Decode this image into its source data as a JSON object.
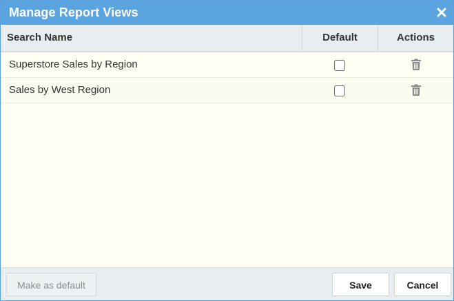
{
  "dialog": {
    "title": "Manage Report Views",
    "close_icon": "close-icon"
  },
  "table": {
    "columns": {
      "name": "Search Name",
      "default": "Default",
      "actions": "Actions"
    },
    "rows": [
      {
        "name": "Superstore Sales by Region",
        "default": false,
        "action_icon": "trash-icon"
      },
      {
        "name": "Sales by West Region",
        "default": false,
        "action_icon": "trash-icon"
      }
    ]
  },
  "footer": {
    "make_default_label": "Make as default",
    "save_label": "Save",
    "cancel_label": "Cancel"
  },
  "colors": {
    "titlebar": "#5aa5e0",
    "body_bg": "#fefef3",
    "header_bg": "#e8eef0"
  }
}
